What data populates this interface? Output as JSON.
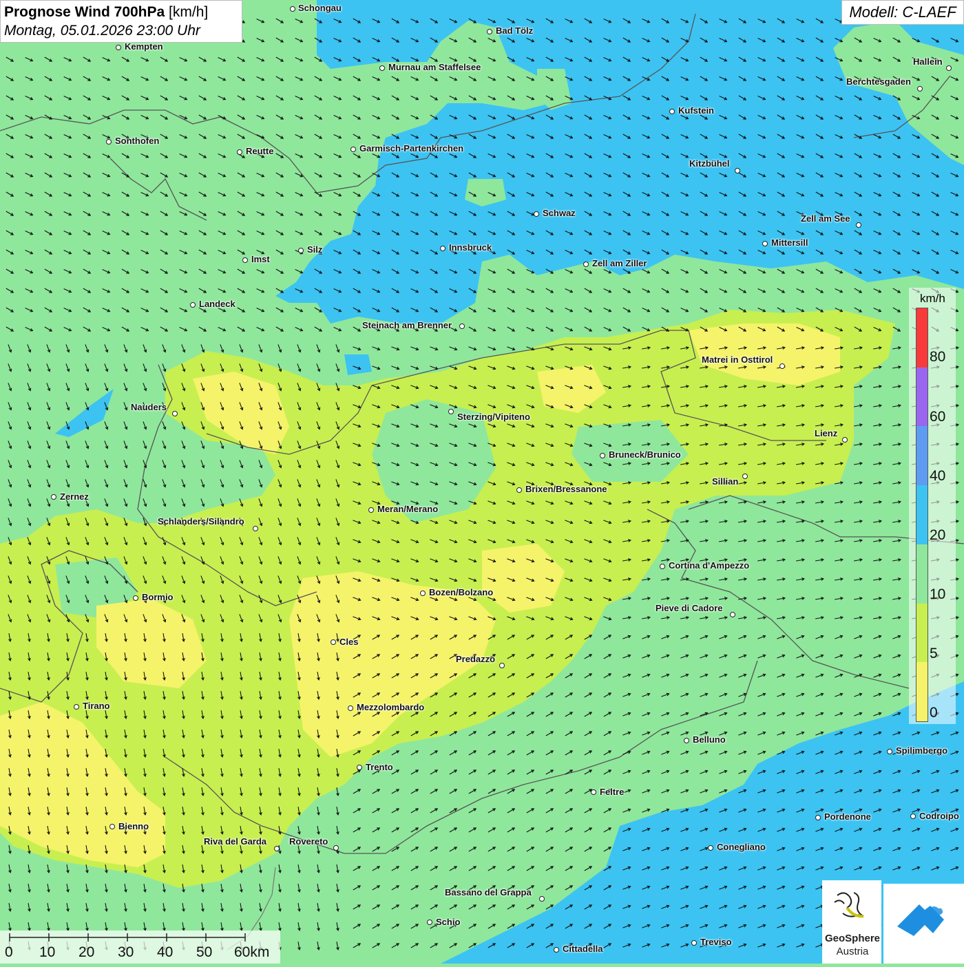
{
  "title": {
    "main": "Prognose Wind 700hPa",
    "unit": "[km/h]",
    "datetime": "Montag, 05.01.2026 23:00 Uhr"
  },
  "model": "Modell: C-LAEF",
  "legend": {
    "unit": "km/h",
    "ticks": [
      "80",
      "60",
      "40",
      "20",
      "10",
      "5",
      "0"
    ],
    "colors": [
      "#f83a3a",
      "#9a66ef",
      "#5e9bf2",
      "#3cc3f2",
      "#8fe79c",
      "#c8ef50",
      "#f5f36a"
    ]
  },
  "scalebar": {
    "labels": [
      "0",
      "10",
      "20",
      "30",
      "40",
      "50",
      "60km"
    ]
  },
  "logo": {
    "name": "GeoSphere",
    "sub": "Austria"
  },
  "cities": [
    {
      "name": "Schongau"
    },
    {
      "name": "Bad Tölz"
    },
    {
      "name": "Kempten"
    },
    {
      "name": "Murnau am Staffelsee"
    },
    {
      "name": "Hallein"
    },
    {
      "name": "Berchtesgaden"
    },
    {
      "name": "Kufstein"
    },
    {
      "name": "Sonthofen"
    },
    {
      "name": "Reutte"
    },
    {
      "name": "Garmisch-Partenkirchen"
    },
    {
      "name": "Kitzbühel"
    },
    {
      "name": "Schwaz"
    },
    {
      "name": "Zell am See"
    },
    {
      "name": "Mittersill"
    },
    {
      "name": "Innsbruck"
    },
    {
      "name": "Silz"
    },
    {
      "name": "Imst"
    },
    {
      "name": "Zell am Ziller"
    },
    {
      "name": "Landeck"
    },
    {
      "name": "Steinach am Brenner"
    },
    {
      "name": "Matrei in Osttirol"
    },
    {
      "name": "Nauders"
    },
    {
      "name": "Sterzing/Vipiteno"
    },
    {
      "name": "Lienz"
    },
    {
      "name": "Bruneck/Brunico"
    },
    {
      "name": "Sillian"
    },
    {
      "name": "Zernez"
    },
    {
      "name": "Brixen/Bressanone"
    },
    {
      "name": "Meran/Merano"
    },
    {
      "name": "Schlanders/Silandro"
    },
    {
      "name": "Cortina d'Ampezzo"
    },
    {
      "name": "Bozen/Bolzano"
    },
    {
      "name": "Bormio"
    },
    {
      "name": "Pieve di Cadore"
    },
    {
      "name": "Cles"
    },
    {
      "name": "Predazzo"
    },
    {
      "name": "Tirano"
    },
    {
      "name": "Mezzolombardo"
    },
    {
      "name": "Belluno"
    },
    {
      "name": "Spilimbergo"
    },
    {
      "name": "Trento"
    },
    {
      "name": "Feltre"
    },
    {
      "name": "Pordenone"
    },
    {
      "name": "Codroipo"
    },
    {
      "name": "Bienno"
    },
    {
      "name": "Riva del Garda"
    },
    {
      "name": "Rovereto"
    },
    {
      "name": "Conegliano"
    },
    {
      "name": "Bassano del Grappa"
    },
    {
      "name": "Schio"
    },
    {
      "name": "Treviso"
    },
    {
      "name": "Cittadella"
    }
  ]
}
